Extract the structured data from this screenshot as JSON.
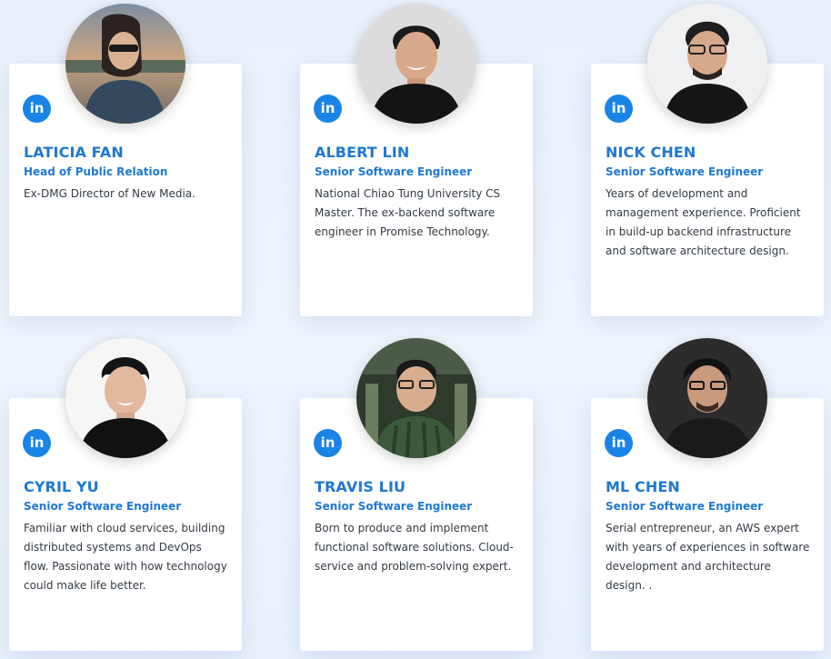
{
  "members": [
    {
      "name": "LATICIA FAN",
      "role": "Head of Public Relation",
      "description": "Ex-DMG Director of New Media.",
      "linkedin_icon": "in"
    },
    {
      "name": "ALBERT LIN",
      "role": "Senior Software Engineer",
      "description": "National Chiao Tung University CS Master. The ex-backend software engineer in Promise Technology.",
      "linkedin_icon": "in"
    },
    {
      "name": "NICK CHEN",
      "role": "Senior Software Engineer",
      "description": "Years of development and management experience. Proficient in build-up backend infrastructure and software architecture design.",
      "linkedin_icon": "in"
    },
    {
      "name": "CYRIL YU",
      "role": "Senior Software Engineer",
      "description": "Familiar with cloud services, building distributed systems and DevOps flow. Passionate with how technology could make life better.",
      "linkedin_icon": "in"
    },
    {
      "name": "TRAVIS LIU",
      "role": "Senior Software Engineer",
      "description": "Born to produce and implement functional software solutions. Cloud-service and problem-solving expert.",
      "linkedin_icon": "in"
    },
    {
      "name": "ML CHEN",
      "role": "Senior Software Engineer",
      "description": "Serial entrepreneur, an AWS expert with years of experiences in software development and architecture design. .",
      "linkedin_icon": "in"
    }
  ],
  "colors": {
    "accent": "#1f78d1",
    "linkedin": "#1a84e6",
    "text": "#333b45",
    "background": "#e9f1fb"
  }
}
